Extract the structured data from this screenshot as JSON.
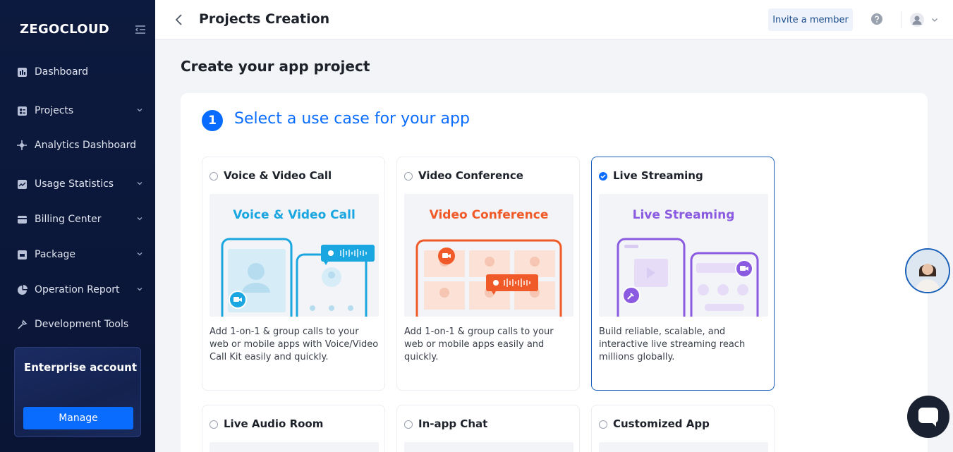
{
  "sidebar": {
    "logo": "ZEGOCLOUD",
    "items": [
      {
        "label": "Dashboard",
        "icon": "dashboard-icon",
        "has_chevron": false
      },
      {
        "label": "Projects",
        "icon": "projects-icon",
        "has_chevron": true
      },
      {
        "label": "Analytics Dashboard",
        "icon": "analytics-icon",
        "has_chevron": false
      },
      {
        "label": "Usage Statistics",
        "icon": "usage-icon",
        "has_chevron": true
      },
      {
        "label": "Billing Center",
        "icon": "billing-icon",
        "has_chevron": true
      },
      {
        "label": "Package",
        "icon": "package-icon",
        "has_chevron": true
      },
      {
        "label": "Operation Report",
        "icon": "report-icon",
        "has_chevron": true
      },
      {
        "label": "Development Tools",
        "icon": "tools-icon",
        "has_chevron": false
      }
    ],
    "enterprise": {
      "title": "Enterprise account",
      "button": "Manage"
    }
  },
  "topbar": {
    "title": "Projects Creation",
    "invite_label": "Invite a member"
  },
  "main": {
    "heading": "Create your app project",
    "step": {
      "number": "1",
      "title": "Select a use case for your app"
    },
    "cards": [
      {
        "name": "Voice & Video Call",
        "preview_title": "Voice & Video Call",
        "desc": "Add 1-on-1 & group calls to your web or mobile apps with Voice/Video Call Kit easily and quickly.",
        "selected": false,
        "color": "#1aa6e0"
      },
      {
        "name": "Video Conference",
        "preview_title": "Video Conference",
        "desc": "Add 1-on-1 & group calls to your web or mobile apps easily and quickly.",
        "selected": false,
        "color": "#f05a28"
      },
      {
        "name": "Live Streaming",
        "preview_title": "Live Streaming",
        "desc": "Build reliable, scalable, and interactive live streaming reach millions globally.",
        "selected": true,
        "color": "#8a5ae0"
      },
      {
        "name": "Live Audio Room",
        "selected": false
      },
      {
        "name": "In-app Chat",
        "selected": false
      },
      {
        "name": "Customized App",
        "selected": false
      }
    ]
  },
  "colors": {
    "primary": "#0a6cff",
    "sidebar_bg": "#0d1a3f"
  }
}
